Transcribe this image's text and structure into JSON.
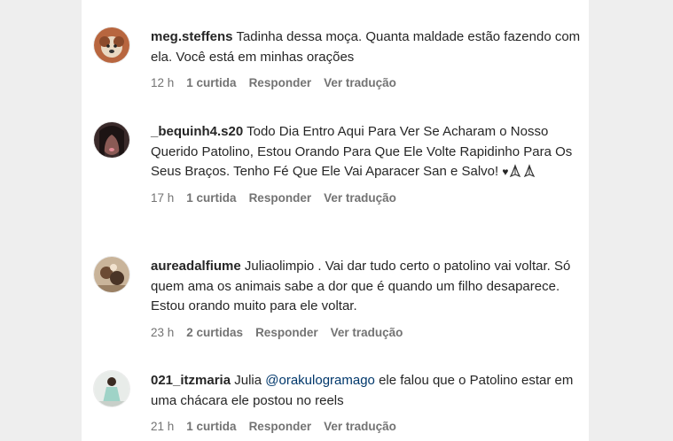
{
  "comments": [
    {
      "username": "meg.steffens",
      "text": "Tadinha dessa moça. Quanta maldade estão fazendo com ela. Você está em minhas orações",
      "time": "12 h",
      "likes": "1 curtida",
      "reply": "Responder",
      "translate": "Ver tradução"
    },
    {
      "username": "_bequinh4.s20",
      "text": "Todo Dia Entro Aqui Para Ver Se Acharam o Nosso Querido Patolino, Estou Orando Para Que Ele Volte Rapidinho Para Os Seus Braços. Tenho Fé Que Ele Vai Aparacer San e Salvo!",
      "emoji": "♥",
      "time": "17 h",
      "likes": "1 curtida",
      "reply": "Responder",
      "translate": "Ver tradução"
    },
    {
      "username": "aureadalfiume",
      "text": "Juliaolimpio . Vai dar tudo certo o patolino vai voltar. Só quem ama os animais sabe a dor que é quando um filho desaparece. Estou orando muito para ele voltar.",
      "time": "23 h",
      "likes": "2 curtidas",
      "reply": "Responder",
      "translate": "Ver tradução"
    },
    {
      "username": "021_itzmaria",
      "text_before": "Julia ",
      "mention": "@orakulogramago",
      "text_after": " ele falou que o Patolino estar em uma chácara ele postou no reels",
      "time": "21 h",
      "likes": "1 curtida",
      "reply": "Responder",
      "translate": "Ver tradução"
    }
  ],
  "colors": {
    "text": "#262626",
    "meta": "#737373",
    "mention": "#00376b",
    "background": "#eeeeee",
    "panel": "#ffffff"
  }
}
